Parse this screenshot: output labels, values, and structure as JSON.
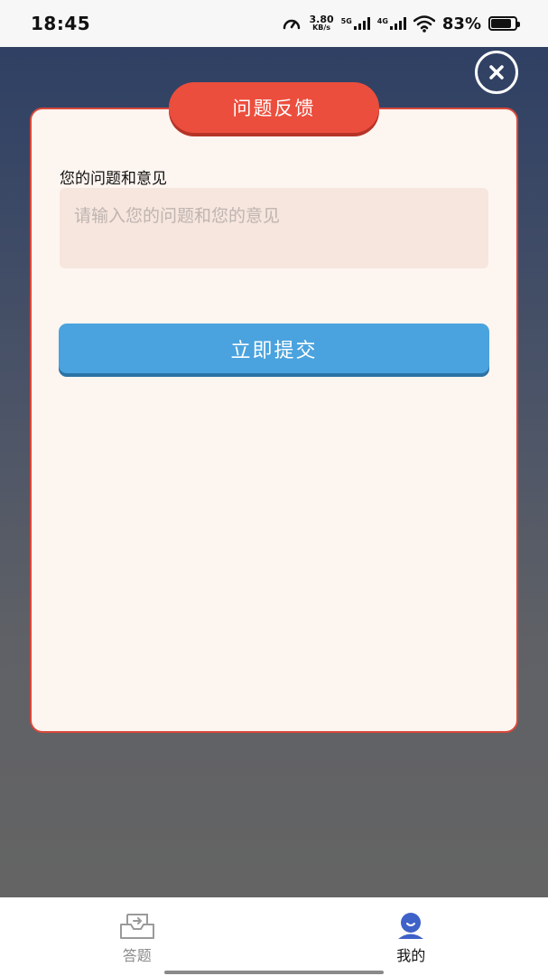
{
  "status_bar": {
    "time": "18:45",
    "net_speed_value": "3.80",
    "net_speed_unit": "KB/s",
    "sim1_tag": "5G",
    "sim2_tag": "4G",
    "battery_percent": "83%",
    "battery_level": 0.83
  },
  "dialog": {
    "title": "问题反馈",
    "field_label": "您的问题和意见",
    "input_value": "",
    "input_placeholder": "请输入您的问题和您的意见",
    "submit_label": "立即提交",
    "accent_color": "#ec4e3d",
    "button_color": "#4aa3de"
  },
  "bottom_nav": {
    "items": [
      {
        "label": "答题",
        "icon": "answer-tray-icon",
        "active": false
      },
      {
        "label": "我的",
        "icon": "profile-icon",
        "active": true
      }
    ]
  }
}
